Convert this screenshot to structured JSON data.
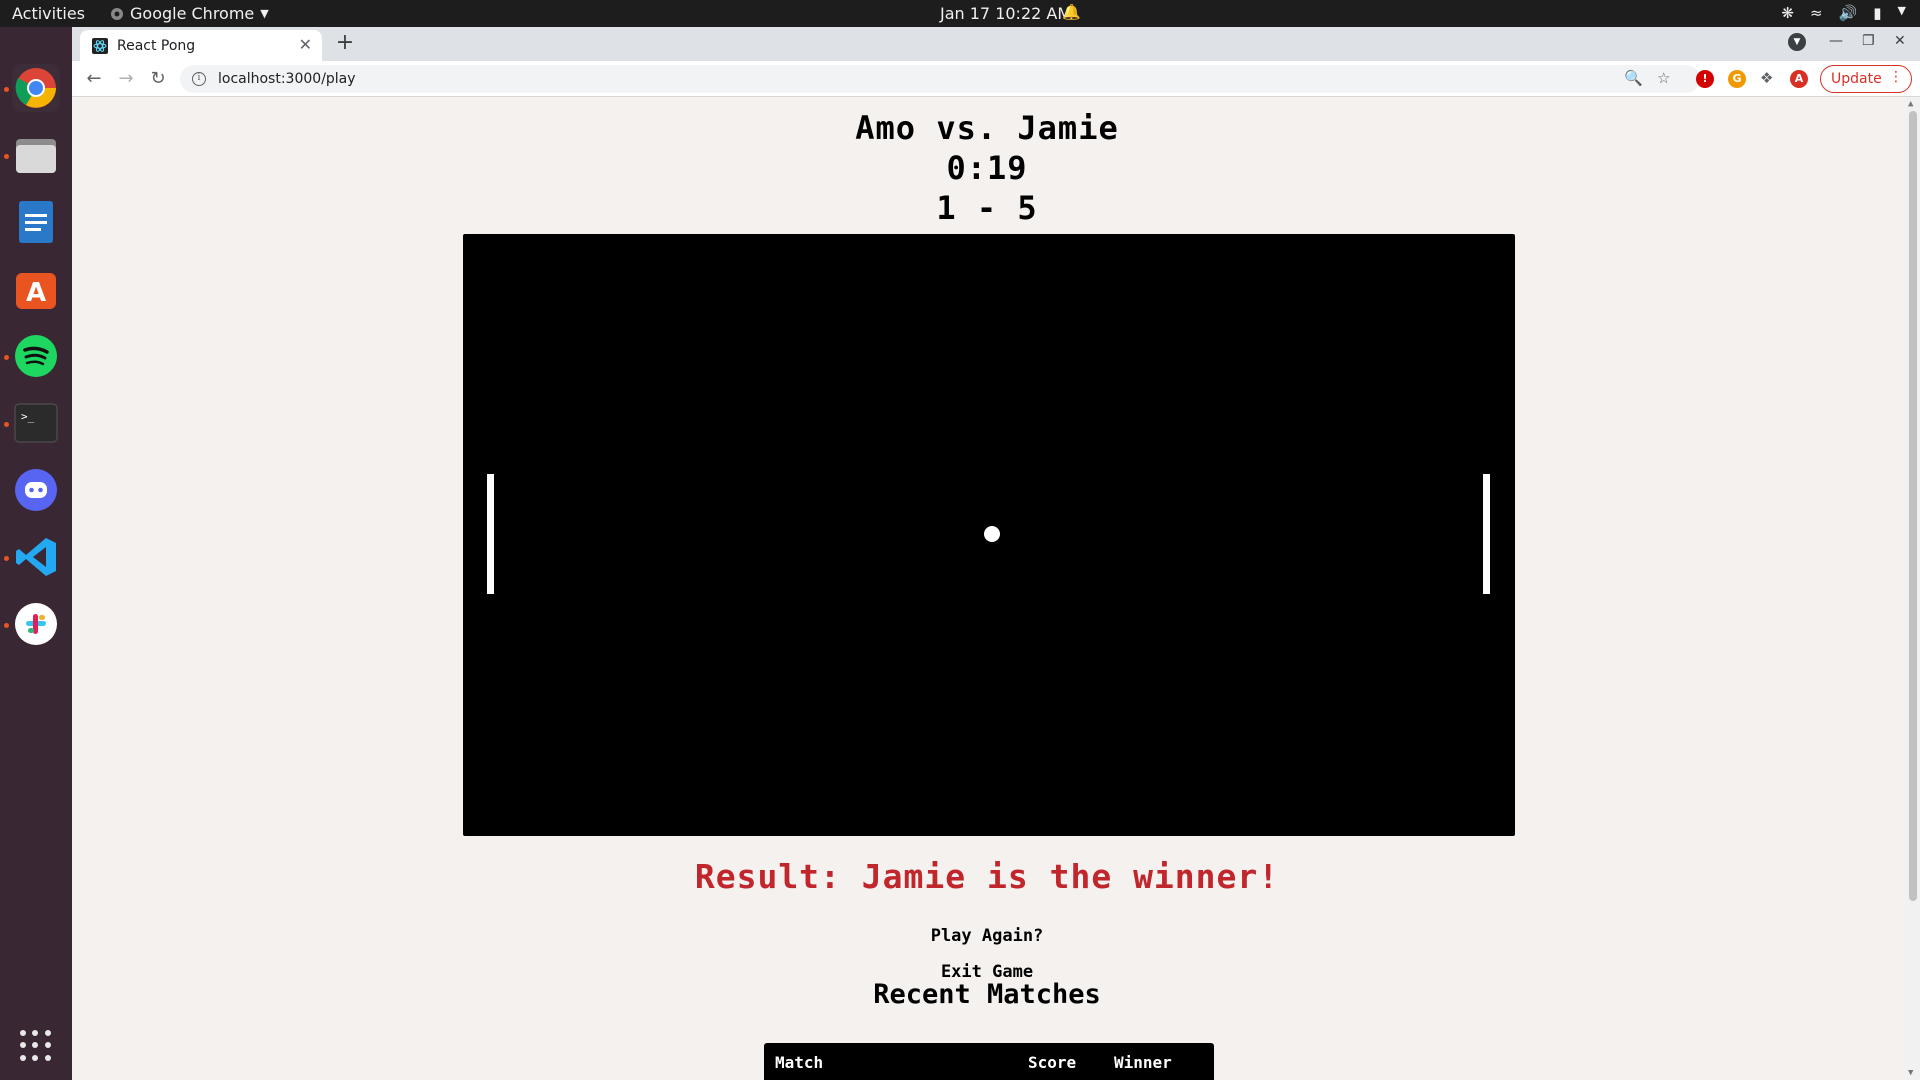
{
  "topbar": {
    "activities": "Activities",
    "app_name": "Google Chrome",
    "clock": "Jan 17  10:22 AM"
  },
  "dock": {
    "items": [
      "chrome-icon",
      "files-icon",
      "writer-icon",
      "software-center-icon",
      "spotify-icon",
      "terminal-icon",
      "discord-icon",
      "vscode-icon",
      "slack-icon"
    ]
  },
  "browser": {
    "tab_title": "React Pong",
    "url": "localhost:3000/play",
    "update_label": "Update",
    "profile_initial": "A"
  },
  "game": {
    "matchup": "Amo vs. Jamie",
    "timer": "0:19",
    "score": "1 - 5",
    "result": "Result: Jamie is the winner!",
    "play_again": "Play Again?",
    "exit": "Exit Game"
  },
  "recent_matches": {
    "title": "Recent Matches",
    "columns": [
      "Match",
      "Score",
      "Winner"
    ]
  },
  "colors": {
    "result": "#c0262b",
    "board": "#000000",
    "page_bg": "#f4f1ee",
    "update_accent": "#d93025"
  }
}
